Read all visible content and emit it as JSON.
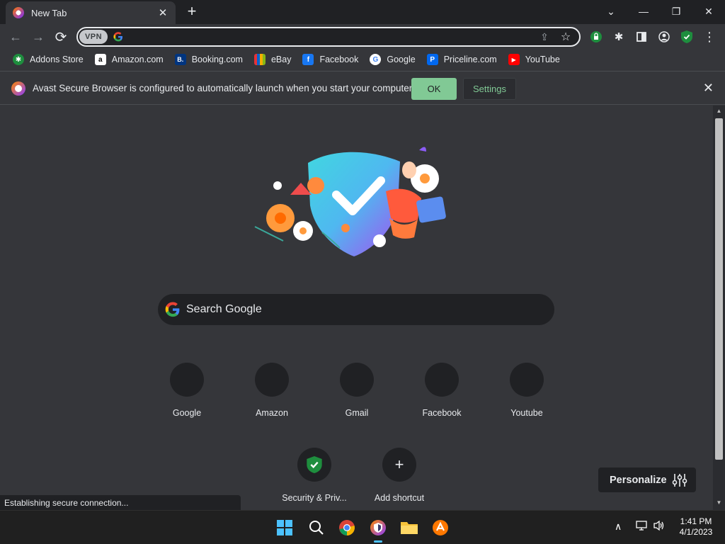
{
  "window": {
    "tab_title": "New Tab",
    "tab_close_glyph": "✕",
    "newtab_glyph": "+",
    "controls": {
      "chevron": "⌄",
      "minimize": "—",
      "restore": "❐",
      "close": "✕"
    }
  },
  "toolbar": {
    "back_glyph": "←",
    "forward_glyph": "→",
    "reload_glyph": "⟳",
    "vpn_label": "VPN",
    "url": "",
    "share_glyph": "⇪",
    "star_glyph": "☆",
    "extensions_glyph": "✱",
    "sidepanel_glyph": "▮",
    "profile_glyph": "◯",
    "menu_glyph": "⋮"
  },
  "bookmarks": [
    {
      "label": "Addons Store",
      "icon": "addons-store-icon",
      "color": "#1e8e3e",
      "glyph": "✱"
    },
    {
      "label": "Amazon.com",
      "icon": "amazon-icon",
      "color": "#ffffff",
      "glyph": "a"
    },
    {
      "label": "Booking.com",
      "icon": "booking-icon",
      "color": "#003580",
      "glyph": "B."
    },
    {
      "label": "eBay",
      "icon": "ebay-icon",
      "color": "#e53238",
      "glyph": "▬"
    },
    {
      "label": "Facebook",
      "icon": "facebook-icon",
      "color": "#1877f2",
      "glyph": "f"
    },
    {
      "label": "Google",
      "icon": "google-icon",
      "color": "#ffffff",
      "glyph": "G"
    },
    {
      "label": "Priceline.com",
      "icon": "priceline-icon",
      "color": "#0068ef",
      "glyph": "P"
    },
    {
      "label": "YouTube",
      "icon": "youtube-icon",
      "color": "#ff0000",
      "glyph": "▶"
    }
  ],
  "infobar": {
    "message": "Avast Secure Browser is configured to automatically launch when you start your computer.",
    "ok_label": "OK",
    "settings_label": "Settings",
    "close_glyph": "✕"
  },
  "newtab": {
    "search_placeholder": "Search Google",
    "tiles": [
      {
        "label": "Google"
      },
      {
        "label": "Amazon"
      },
      {
        "label": "Gmail"
      },
      {
        "label": "Facebook"
      },
      {
        "label": "Youtube"
      }
    ],
    "tiles_row2": [
      {
        "label": "Security & Priv..."
      },
      {
        "label": "Add shortcut",
        "glyph": "+"
      }
    ],
    "personalize_label": "Personalize"
  },
  "status_text": "Establishing secure connection...",
  "taskbar": {
    "apps": [
      "windows-start-icon",
      "search-icon",
      "chrome-icon",
      "avast-browser-icon",
      "file-explorer-icon",
      "avast-antivirus-icon"
    ],
    "tray_up_glyph": "∧",
    "time": "1:41 PM",
    "date": "4/1/2023"
  },
  "colors": {
    "accent_green": "#81c995",
    "background": "#35363a",
    "frame": "#202124"
  }
}
